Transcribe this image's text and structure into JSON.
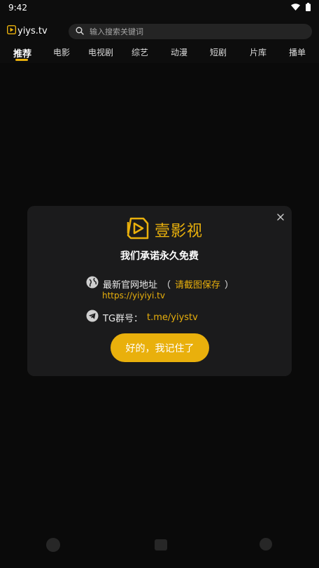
{
  "status": {
    "time": "9:42"
  },
  "header": {
    "logo_text": "yiys.tv",
    "search_placeholder": "输入搜索关键词"
  },
  "tabs": [
    {
      "label": "推荐",
      "active": true
    },
    {
      "label": "电影"
    },
    {
      "label": "电视剧"
    },
    {
      "label": "综艺"
    },
    {
      "label": "动漫"
    },
    {
      "label": "短剧"
    },
    {
      "label": "片库"
    },
    {
      "label": "播单"
    }
  ],
  "modal": {
    "brand": "壹影视",
    "title": "我们承诺永久免费",
    "site_label": "最新官网地址",
    "site_paren_open": "（",
    "site_hint": "请截图保存",
    "site_paren_close": "）",
    "site_url": "https://yiyiyi.tv",
    "tg_label": "TG群号：",
    "tg_link": "t.me/yiystv",
    "confirm_label": "好的，我记住了"
  },
  "colors": {
    "accent": "#e9b00c",
    "background": "#0d0d0d",
    "modal": "#1b1b1c"
  }
}
